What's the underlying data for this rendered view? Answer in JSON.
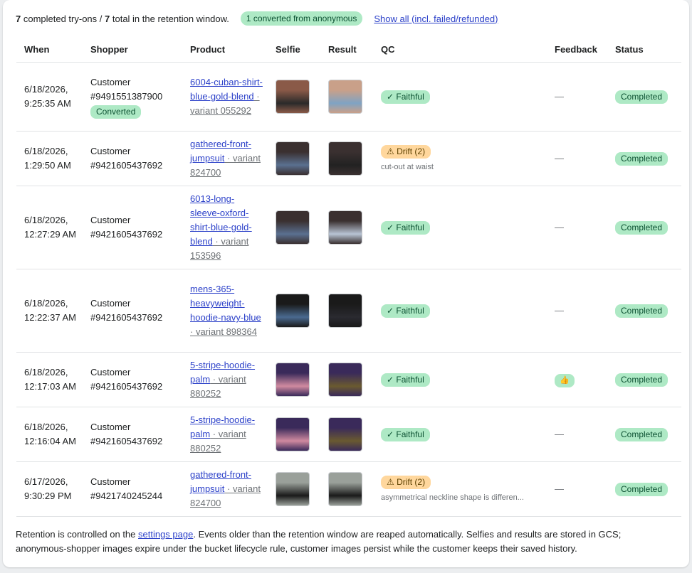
{
  "summary": {
    "completed_count": "7",
    "completed_text": " completed try-ons / ",
    "total_count": "7",
    "total_text": " total in the retention window.",
    "converted_pill": "1 converted from anonymous",
    "show_all_link": "Show all (incl. failed/refunded)"
  },
  "columns": {
    "when": "When",
    "shopper": "Shopper",
    "product": "Product",
    "selfie": "Selfie",
    "result": "Result",
    "qc": "QC",
    "feedback": "Feedback",
    "status": "Status"
  },
  "rows": [
    {
      "when": "6/18/2026, 9:25:35 AM",
      "shopper": "Customer #9491551387900",
      "converted": "Converted",
      "product": "6004-cuban-shirt-blue-gold-blend",
      "variant": " · variant 055292",
      "qc": "✓ Faithful",
      "qc_type": "faithful",
      "qc_note": "",
      "feedback": "—",
      "status": "Completed",
      "selfie_colors": [
        "#8a5a48",
        "#2a2a2a"
      ],
      "result_colors": [
        "#c9a089",
        "#7fa3c4"
      ]
    },
    {
      "when": "6/18/2026, 1:29:50 AM",
      "shopper": "Customer #9421605437692",
      "converted": "",
      "product": "gathered-front-jumpsuit",
      "variant": " · variant 824700",
      "qc": "⚠ Drift (2)",
      "qc_type": "drift",
      "qc_note": "cut-out at waist",
      "feedback": "—",
      "status": "Completed",
      "selfie_colors": [
        "#3a3030",
        "#5a7090"
      ],
      "result_colors": [
        "#3a3030",
        "#222222"
      ]
    },
    {
      "when": "6/18/2026, 12:27:29 AM",
      "shopper": "Customer #9421605437692",
      "converted": "",
      "product": "6013-long-sleeve-oxford-shirt-blue-gold-blend",
      "variant": " · variant 153596",
      "qc": "✓ Faithful",
      "qc_type": "faithful",
      "qc_note": "",
      "feedback": "—",
      "status": "Completed",
      "selfie_colors": [
        "#3a3030",
        "#5a7090"
      ],
      "result_colors": [
        "#3a3030",
        "#b8c4d4"
      ]
    },
    {
      "when": "6/18/2026, 12:22:37 AM",
      "shopper": "Customer #9421605437692",
      "converted": "",
      "product": "mens-365-heavyweight-hoodie-navy-blue",
      "variant": " · variant 898364",
      "qc": "✓ Faithful",
      "qc_type": "faithful",
      "qc_note": "",
      "feedback": "—",
      "status": "Completed",
      "selfie_colors": [
        "#1a1a1a",
        "#4a6a90"
      ],
      "result_colors": [
        "#1a1a1a",
        "#2a2a30"
      ]
    },
    {
      "when": "6/18/2026, 12:17:03 AM",
      "shopper": "Customer #9421605437692",
      "converted": "",
      "product": "5-stripe-hoodie-palm",
      "variant": " · variant 880252",
      "qc": "✓ Faithful",
      "qc_type": "faithful",
      "qc_note": "",
      "feedback": "👍",
      "status": "Completed",
      "selfie_colors": [
        "#3a2a5a",
        "#d08aa0"
      ],
      "result_colors": [
        "#3a2a5a",
        "#6a5a30"
      ]
    },
    {
      "when": "6/18/2026, 12:16:04 AM",
      "shopper": "Customer #9421605437692",
      "converted": "",
      "product": "5-stripe-hoodie-palm",
      "variant": " · variant 880252",
      "qc": "✓ Faithful",
      "qc_type": "faithful",
      "qc_note": "",
      "feedback": "—",
      "status": "Completed",
      "selfie_colors": [
        "#3a2a5a",
        "#d08aa0"
      ],
      "result_colors": [
        "#3a2a5a",
        "#6a5a30"
      ]
    },
    {
      "when": "6/17/2026, 9:30:29 PM",
      "shopper": "Customer #9421740245244",
      "converted": "",
      "product": "gathered-front-jumpsuit",
      "variant": " · variant 824700",
      "qc": "⚠ Drift (2)",
      "qc_type": "drift",
      "qc_note": "asymmetrical neckline shape is differen...",
      "feedback": "—",
      "status": "Completed",
      "selfie_colors": [
        "#9aa09a",
        "#1a1a1a"
      ],
      "result_colors": [
        "#9aa09a",
        "#1a1a1a"
      ]
    }
  ],
  "footer": {
    "text_1": "Retention is controlled on the ",
    "settings_link": "settings page",
    "text_2": ". Events older than the retention window are reaped automatically. Selfies and results are stored in GCS; anonymous-shopper images expire under the bucket lifecycle rule, customer images persist while the customer keeps their saved history."
  }
}
